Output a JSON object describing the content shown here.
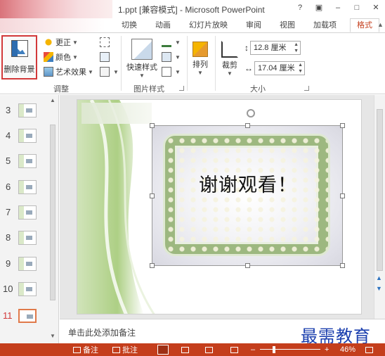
{
  "title": {
    "text": "1.ppt [兼容模式] - Microsoft PowerPoint"
  },
  "window_controls": {
    "help": "?",
    "restore": "▣",
    "minimize": "–",
    "maximize": "□",
    "close": "✕"
  },
  "tabs": {
    "transitions": "切换",
    "animations": "动画",
    "slideshow": "幻灯片放映",
    "review": "审阅",
    "view": "视图",
    "addins": "加载项",
    "format": "格式"
  },
  "ribbon": {
    "adjust": {
      "remove_background": "删除背景",
      "corrections": "更正",
      "color": "颜色",
      "artistic_effects": "艺术效果",
      "group_label": "调整"
    },
    "picture_styles": {
      "quick_styles": "快速样式",
      "group_label": "图片样式"
    },
    "arrange": {
      "label": "排列"
    },
    "size": {
      "crop": "裁剪",
      "height_value": "12.8 厘米",
      "width_value": "17.04 厘米",
      "group_label": "大小"
    }
  },
  "slides": {
    "numbers": [
      "3",
      "4",
      "5",
      "6",
      "7",
      "8",
      "9",
      "10",
      "11"
    ],
    "selected": "11"
  },
  "slide_content": {
    "text": "谢谢观看！"
  },
  "notes": {
    "placeholder": "单击此处添加备注"
  },
  "statusbar": {
    "notes": "备注",
    "comments": "批注",
    "zoom": "46%",
    "minus": "–",
    "plus": "+"
  },
  "watermark": {
    "text": "最需教育"
  },
  "colors": {
    "accent": "#c43e1c",
    "highlight": "#d2393a"
  }
}
